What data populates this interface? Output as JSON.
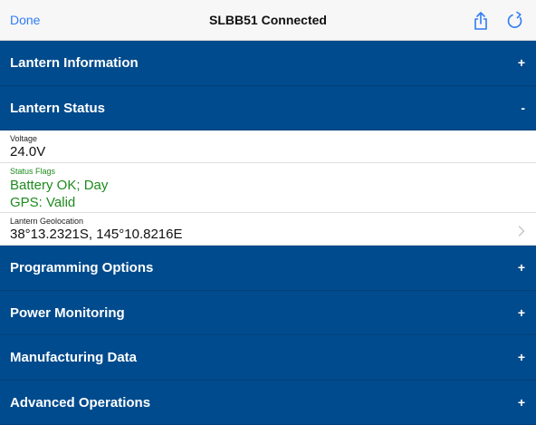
{
  "navbar": {
    "done_label": "Done",
    "title": "SLBB51 Connected",
    "share_icon": "share-icon",
    "refresh_icon": "refresh-icon",
    "accent_color": "#2f7cf6"
  },
  "sections": {
    "lantern_information": {
      "label": "Lantern Information",
      "toggle": "+"
    },
    "lantern_status": {
      "label": "Lantern Status",
      "toggle": "-"
    },
    "programming_options": {
      "label": "Programming Options",
      "toggle": "+"
    },
    "power_monitoring": {
      "label": "Power Monitoring",
      "toggle": "+"
    },
    "manufacturing_data": {
      "label": "Manufacturing Data",
      "toggle": "+"
    },
    "advanced_operations": {
      "label": "Advanced Operations",
      "toggle": "+"
    }
  },
  "status": {
    "voltage_label": "Voltage",
    "voltage_value": "24.0V",
    "flags_label": "Status Flags",
    "flags_line1": "Battery OK; Day",
    "flags_line2": "GPS: Valid",
    "geo_label": "Lantern Geolocation",
    "geo_value": "38°13.2321S, 145°10.8216E",
    "status_color": "#1e8b1e"
  },
  "colors": {
    "section_bg": "#004b8d"
  }
}
